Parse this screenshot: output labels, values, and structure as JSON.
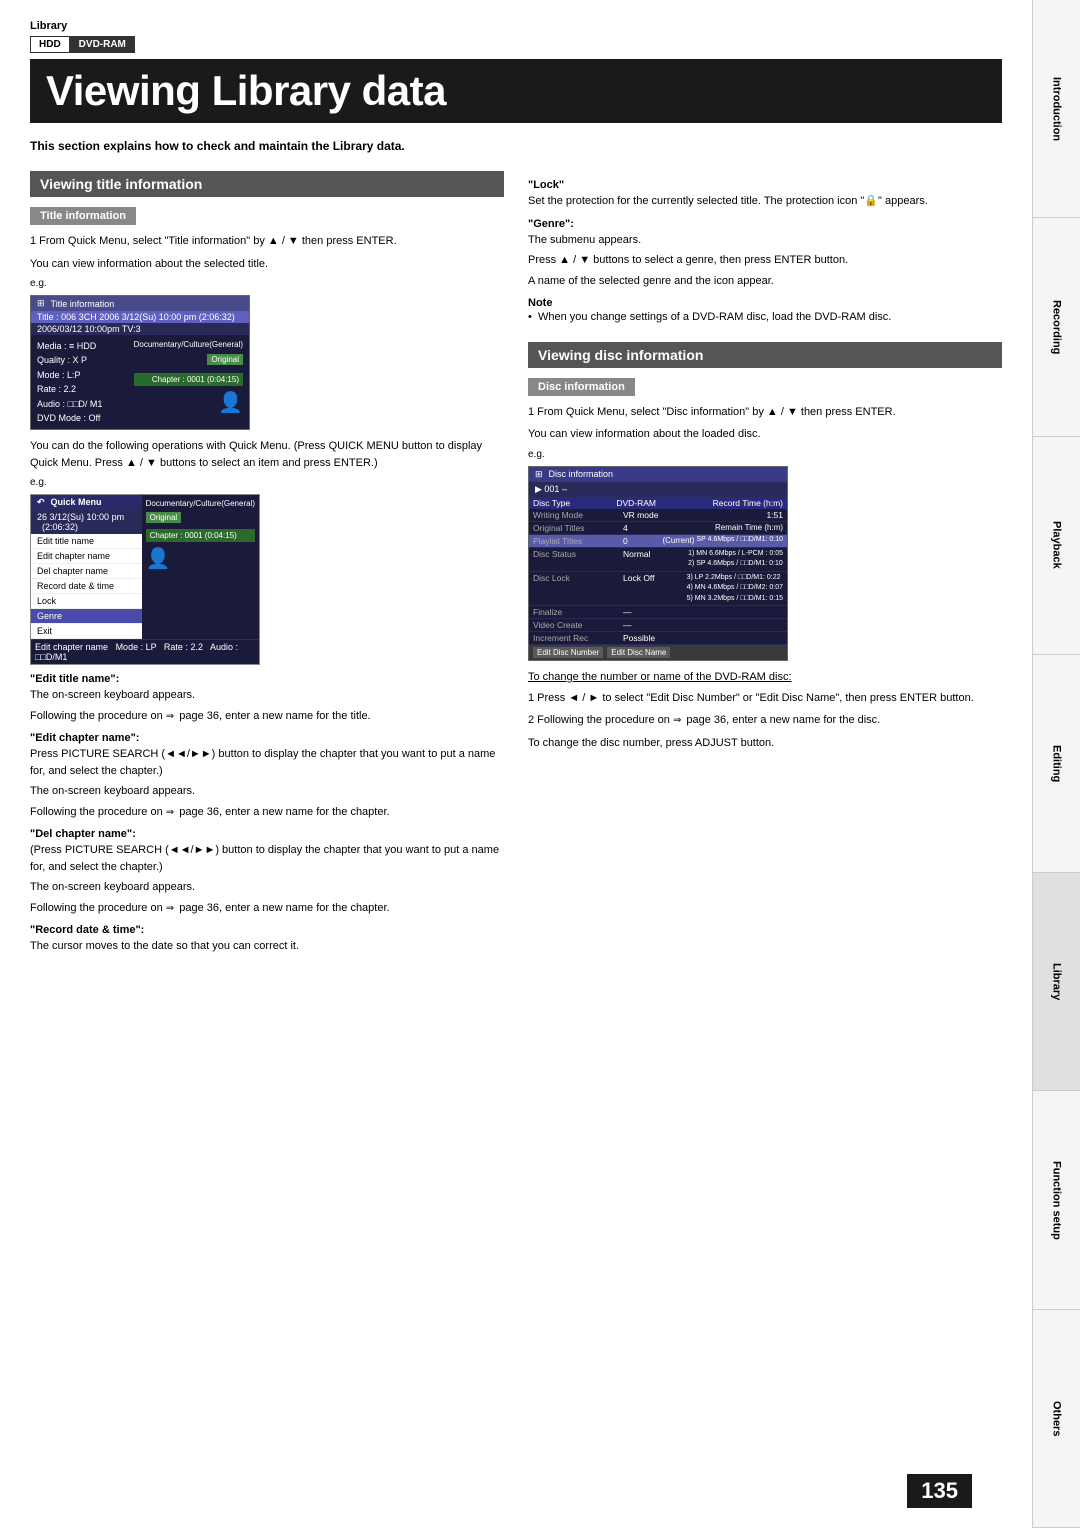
{
  "page": {
    "category": "Library",
    "badges": [
      "HDD",
      "DVD-RAM"
    ],
    "title": "Viewing Library data",
    "intro": "This section explains how to check and maintain the Library data.",
    "page_number": "135"
  },
  "sidebar": {
    "tabs": [
      {
        "label": "Introduction",
        "active": false
      },
      {
        "label": "Recording",
        "active": false
      },
      {
        "label": "Playback",
        "active": false
      },
      {
        "label": "Editing",
        "active": false
      },
      {
        "label": "Library",
        "active": true
      },
      {
        "label": "Function setup",
        "active": false
      },
      {
        "label": "Others",
        "active": false
      }
    ]
  },
  "left_section": {
    "title": "Viewing title information",
    "subsection": "Title information",
    "step1": {
      "instruction": "1  From Quick Menu, select \"Title information\" by ▲ / ▼ then press ENTER.",
      "note": "You can view information about the selected title."
    },
    "eg_screen": {
      "title": "Title information",
      "row1": "Title : 006   3CH  2006  3/12(Su)  10:00 pm   (2:06:32)",
      "row2": "2006/03/12 10:00pm TV:3",
      "media": "Media : ≡ HDD",
      "quality": "Quality : X P",
      "mode": "Mode : L:P",
      "rate": "Rate : 2.2",
      "audio": "Audio : □□D/ M1",
      "dvd": "DVD Mode : Off",
      "category": "Documentary/Culture(General)",
      "chapter": "Chapter : 0001  (0:04:15)",
      "label_original": "Original"
    },
    "quick_menu_note": "You can do the following operations with Quick Menu. (Press QUICK MENU button to display Quick Menu. Press ▲ / ▼ buttons to select an item and press ENTER.)",
    "quick_menu": {
      "title": "Quick Menu",
      "header": "6  3/12(Su)  10:00 pm  (2:06:32)",
      "items": [
        {
          "label": "Edit title name",
          "highlight": false
        },
        {
          "label": "Edit chapter name",
          "highlight": false
        },
        {
          "label": "Del chapter name",
          "highlight": false
        },
        {
          "label": "Record date & time",
          "highlight": false
        },
        {
          "label": "Lock",
          "highlight": false
        },
        {
          "label": "Genre",
          "highlight": true
        },
        {
          "label": "Exit",
          "highlight": false
        }
      ],
      "right_panel_label": "Documentary/Culture(General)",
      "right_panel_original": "Original",
      "chapter": "Chapter : 0001  (0:04:15)"
    },
    "edit_title_name": {
      "label": "\"Edit title name\":",
      "text": "The on-screen keyboard appears.",
      "text2": "Following the procedure on",
      "page_ref": "page 36, enter a new name for the title."
    },
    "edit_chapter_name": {
      "label": "\"Edit chapter name\":",
      "text": "Press PICTURE SEARCH (◄◄/►►) button to display the chapter that you want to put a name for, and select the chapter.)",
      "text2": "The on-screen keyboard appears.",
      "text3": "Following the procedure on",
      "page_ref": "page 36, enter a new name for the chapter."
    },
    "del_chapter_name": {
      "label": "\"Del chapter name\":",
      "text": "(Press PICTURE SEARCH (◄◄/►►) button to display the chapter that you want to put a name for, and select the chapter.)",
      "text2": "The on-screen keyboard appears.",
      "text3": "Following the procedure on",
      "page_ref": "page 36, enter a new name for the chapter."
    },
    "record_date": {
      "label": "\"Record date & time\":",
      "text": "The cursor moves to the date so that you can correct it."
    }
  },
  "right_section": {
    "lock_label": "\"Lock\"",
    "lock_text": "Set the protection for the currently selected title. The protection icon \"🔒\" appears.",
    "genre_label": "\"Genre\":",
    "genre_text": "The submenu appears.",
    "genre_text2": "Press ▲ / ▼ buttons to select a genre, then press ENTER button.",
    "genre_text3": "A name of the selected genre and the icon appear.",
    "note_title": "Note",
    "note_item": "When you change settings of a DVD-RAM disc, load the DVD-RAM disc.",
    "disc_section": {
      "title": "Viewing disc information",
      "subsection": "Disc information",
      "step1": {
        "instruction": "1  From Quick Menu, select \"Disc information\" by ▲ / ▼ then press ENTER.",
        "note": "You can view information about the loaded disc."
      },
      "eg_screen": {
        "title": "Disc information",
        "disc_num": "001 –",
        "disc_type_label": "Disc Type",
        "disc_type_val": "DVD-RAM",
        "record_time_label": "Record Time (h:m)",
        "record_time_val": "1:51",
        "writing_mode_label": "Writing Mode",
        "writing_mode_val": "VR mode",
        "original_titles_label": "Original Titles",
        "original_titles_val": "4",
        "remain_label": "Remain Time (h:m)",
        "playlist_label": "Playlist Titles",
        "playlist_val": "0",
        "current_label": "(Current)",
        "current_val": "SP 4.6Mbps /  □□D/M1:  0:10",
        "disc_status_label": "Disc Status",
        "disc_status_val": "Normal",
        "disc_lock_label": "Disc Lock",
        "disc_lock_val": "Lock Off",
        "finalize_label": "Finalize",
        "finalize_val": "—",
        "video_create_label": "Video Create",
        "video_create_val": "—",
        "increment_label": "Increment Rec",
        "increment_val": "Possible",
        "speed_options": [
          "1) MN 6.6Mbps /  L-PCM :  0:05",
          "2) SP 4.6Mbps /  □□D/M1:  0:10",
          "3) LP 2.2Mbps /  □□D/M1:  0:22",
          "4) MN 4.6Mbps /  □□D/M2:  0:07",
          "5) MN 3.2Mbps /  □□D/M1:  0:15"
        ],
        "footer_btns": [
          "Edit Disc Number",
          "Edit Disc Name"
        ]
      },
      "dvd_ram_note": "To change the number or name of the DVD-RAM disc:",
      "step_press": "1  Press ◄ / ► to select \"Edit Disc Number\" or \"Edit Disc Name\", then press ENTER button.",
      "step_follow": "2  Following the procedure on",
      "step_follow2": "page 36, enter a new name for the disc.",
      "step_adjust": "To change the disc number, press ADJUST button."
    }
  }
}
